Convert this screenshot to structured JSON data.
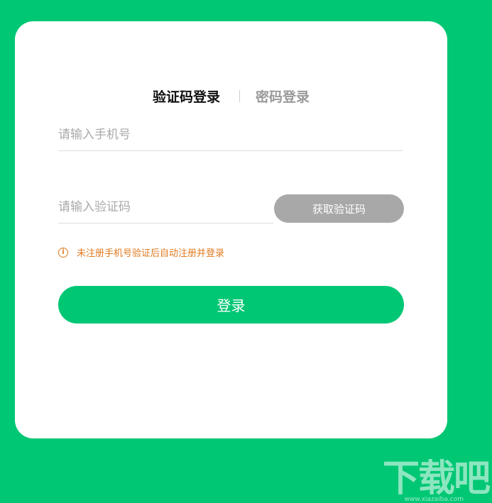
{
  "tabs": {
    "sms_login": "验证码登录",
    "password_login": "密码登录"
  },
  "form": {
    "phone_placeholder": "请输入手机号",
    "code_placeholder": "请输入验证码",
    "get_code_label": "获取验证码",
    "notice_icon": "info-icon",
    "notice": "未注册手机号验证后自动注册并登录",
    "login_label": "登录"
  },
  "watermark": {
    "text": "下载吧",
    "url": "www.xiazaiba.com"
  },
  "colors": {
    "background": "#00c774",
    "accent": "#00c774",
    "disabled_button": "#a8a8a8",
    "notice": "#e07a1f"
  }
}
